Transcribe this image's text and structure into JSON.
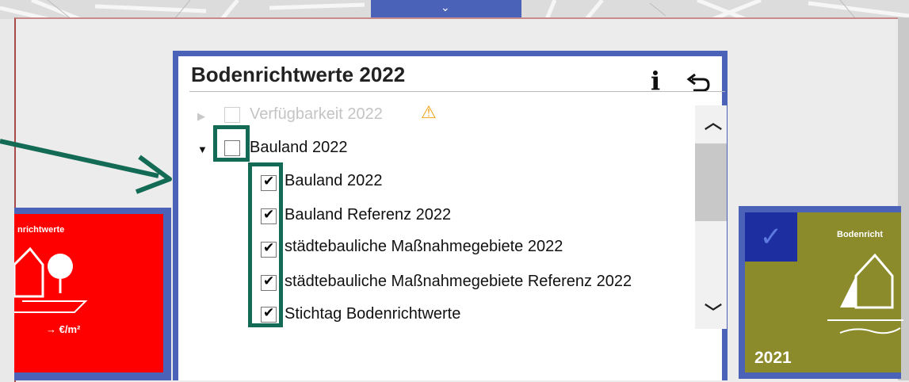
{
  "dialog": {
    "title": "Bodenrichtwerte 2022",
    "info_icon": "ⅰ",
    "back_icon": "undo-arrow"
  },
  "layers": [
    {
      "label": "Verfügbarkeit 2022",
      "checked": false,
      "disabled": true,
      "expander": "▶",
      "warning": "⚠"
    },
    {
      "label": "Bauland 2022",
      "checked": false,
      "disabled": false,
      "expander": "▼"
    },
    {
      "label": "Bauland 2022",
      "checked": true
    },
    {
      "label": "Bauland Referenz 2022",
      "checked": true
    },
    {
      "label": "städtebauliche Maßnahmegebiete 2022",
      "checked": true
    },
    {
      "label": "städtebauliche Maßnahmegebiete Referenz 2022",
      "checked": true
    },
    {
      "label": "Stichtag Bodenrichtwerte",
      "checked": true
    }
  ],
  "scroll": {
    "up": "︿",
    "down": "﹀"
  },
  "tiles": {
    "left": {
      "title": "nrichtwerte",
      "unit": "→  €/m²",
      "color": "#ff0000"
    },
    "right": {
      "title": "Bodenricht",
      "year": "2021",
      "check": "✓",
      "color": "#8b8b2b"
    }
  },
  "colors": {
    "accent": "#4a63b8",
    "highlight": "#146b55",
    "warning": "#f0a010"
  },
  "top_tab": {
    "chevron": "⌄"
  }
}
